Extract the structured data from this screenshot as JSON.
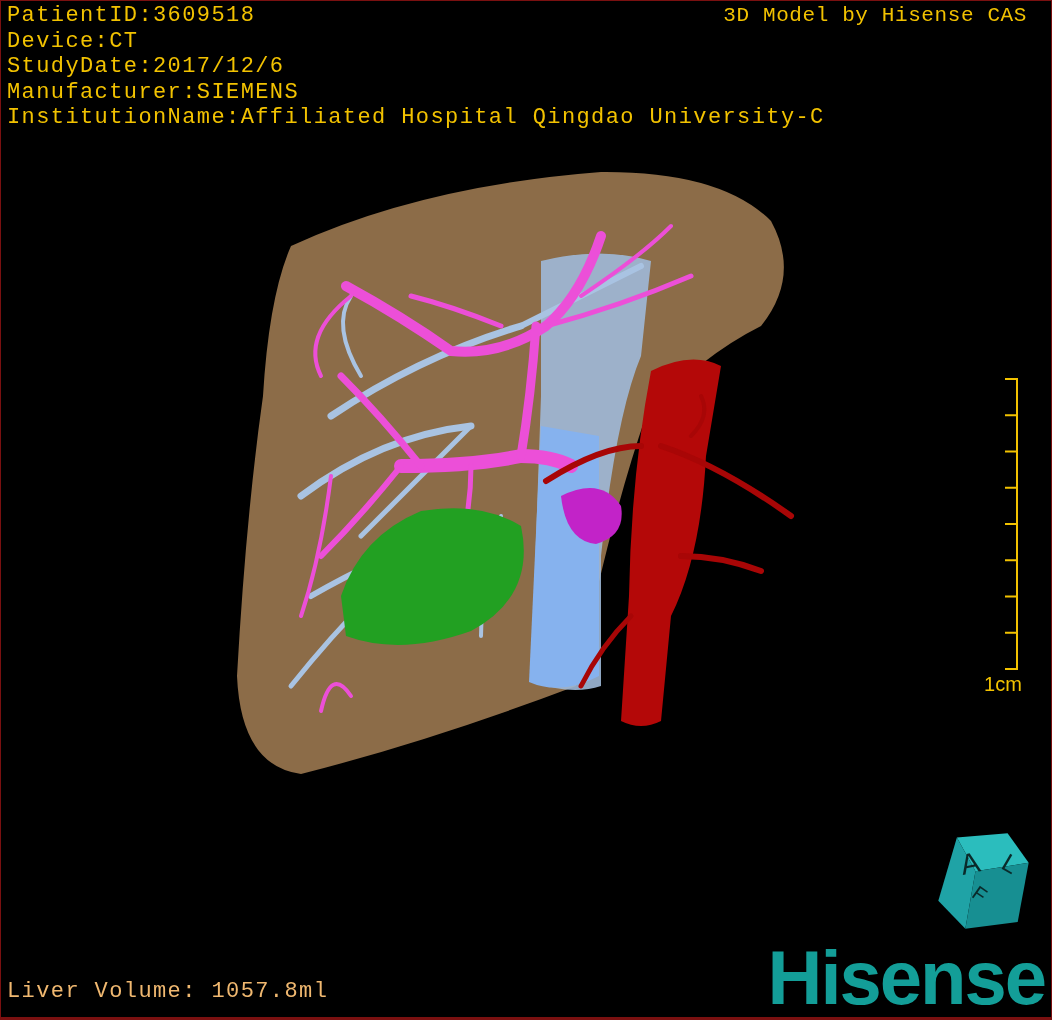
{
  "study_info": [
    "PatientID:3609518",
    "Device:CT",
    "StudyDate:2017/12/6",
    "Manufacturer:SIEMENS",
    "InstitutionName:Affiliated Hospital Qingdao University-C"
  ],
  "credit": "3D Model by Hisense CAS",
  "scale_bar": {
    "label": "1cm"
  },
  "liver_volume": "Liver Volume: 1057.8ml",
  "orientation_cube": {
    "labels": [
      "A",
      "L",
      "F"
    ]
  },
  "logo": "Hisense"
}
